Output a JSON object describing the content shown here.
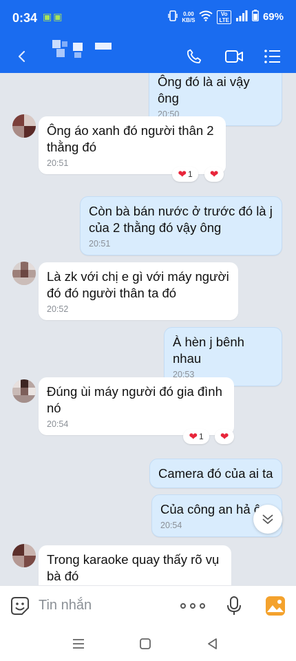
{
  "status_bar": {
    "time": "0:34",
    "network_speed": "0.00\nKB/S",
    "volte": "Vo\nLTE",
    "battery": "69%"
  },
  "header": {
    "contact_name_pixelated": true,
    "icons": [
      "back-icon",
      "phone-icon",
      "video-call-icon",
      "menu-icon"
    ]
  },
  "messages": [
    {
      "id": "m1",
      "direction": "sent",
      "text": "Ông đó là ai vậy ông",
      "time": "20:50"
    },
    {
      "id": "m2",
      "direction": "received",
      "text": "Ông áo xanh đó người thân 2 thằng đó",
      "time": "20:51",
      "reaction": {
        "count": "1"
      }
    },
    {
      "id": "m3",
      "direction": "sent",
      "text": "Còn bà bán nước ở trước đó là j của 2 thằng đó vậy ông",
      "time": "20:51"
    },
    {
      "id": "m4",
      "direction": "received",
      "text": "Là zk với chị e gì với máy người đó đó người thân ta đó",
      "time": "20:52"
    },
    {
      "id": "m5",
      "direction": "sent",
      "text": "À hèn j bênh nhau",
      "time": "20:53"
    },
    {
      "id": "m6",
      "direction": "received",
      "text": "Đúng ùi máy người đó gia đình nó",
      "time": "20:54",
      "reaction": {
        "count": "1"
      }
    },
    {
      "id": "m7",
      "direction": "sent",
      "text": "Camera đó của ai ta",
      "time": ""
    },
    {
      "id": "m8",
      "direction": "sent",
      "text": "Của công an hả ô",
      "time": "20:54"
    },
    {
      "id": "m9",
      "direction": "received",
      "text": "Trong karaoke quay thấy rõ vụ bà đó",
      "time": ""
    }
  ],
  "input_bar": {
    "placeholder": "Tin nhắn"
  },
  "colors": {
    "header_blue": "#1a6cf0",
    "sent_bubble": "#d9ecfd",
    "received_bubble": "#ffffff",
    "chat_background": "#e2e6ec",
    "heart_red": "#e8253a"
  }
}
